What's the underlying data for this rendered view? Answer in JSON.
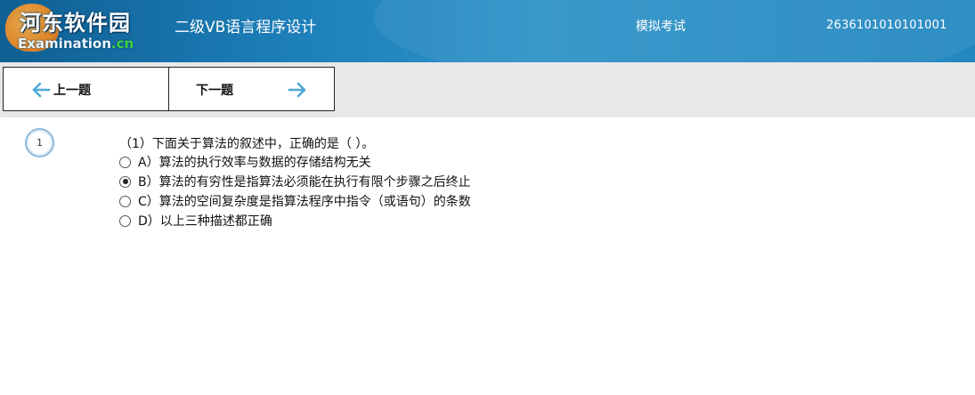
{
  "header": {
    "logo_brand": "河东软件园",
    "logo_sub_prefix": "Examination",
    "logo_sub_suffix": ".cn",
    "title": "二级VB语言程序设计",
    "mode": "模拟考试",
    "exam_id": "2636101010101001"
  },
  "toolbar": {
    "prev_label": "上一题",
    "next_label": "下一题"
  },
  "question": {
    "number": "1",
    "stem": "（1）下面关于算法的叙述中，正确的是（   ）。",
    "selected": "B",
    "options": [
      {
        "key": "A",
        "text": "A）算法的执行效率与数据的存储结构无关"
      },
      {
        "key": "B",
        "text": "B）算法的有穷性是指算法必须能在执行有限个步骤之后终止"
      },
      {
        "key": "C",
        "text": "C）算法的空间复杂度是指算法程序中指令（或语句）的条数"
      },
      {
        "key": "D",
        "text": "D）以上三种描述都正确"
      }
    ]
  },
  "colors": {
    "header": "#1d7fb9",
    "toolbar": "#e8e7ea",
    "arrow": "#4aa8d8"
  },
  "icons": {
    "prev": "arrow-left-icon",
    "next": "arrow-right-icon",
    "radio_on": "radio-checked-icon",
    "radio_off": "radio-unchecked-icon"
  }
}
